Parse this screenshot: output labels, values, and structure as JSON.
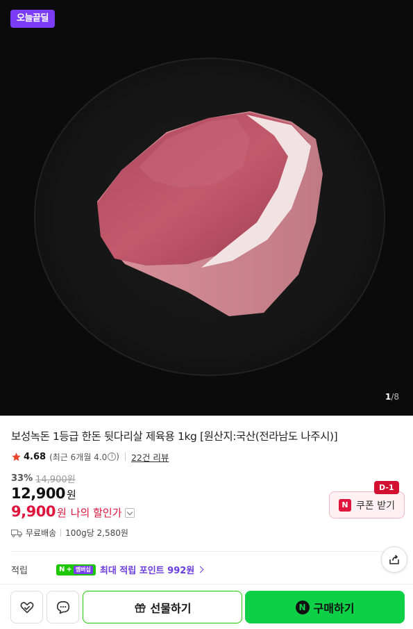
{
  "hero": {
    "badge": "오늘끝딜",
    "image_index": "1",
    "image_total": "/8"
  },
  "product": {
    "title": "보성녹돈 1등급 한돈 뒷다리살 제육용 1kg [원산지:국산(전라남도 나주시)]",
    "rating": "4.68",
    "rating_sub": "(최근 6개월 4.0",
    "rating_info": "i",
    "rating_close": ")",
    "review_link": "22건 리뷰",
    "discount_rate": "33%",
    "original_price": "14,900원",
    "price": "12,900",
    "price_unit": "원",
    "my_price": "9,900",
    "my_price_unit": "원",
    "my_price_label": "나의 할인가"
  },
  "coupon": {
    "dday": "D-1",
    "n_badge": "N",
    "label": "쿠폰 받기"
  },
  "shipping": {
    "free": "무료배송",
    "unit_price": "100g당 2,580원"
  },
  "points": {
    "label": "적립",
    "badge_n": "N",
    "badge_plus": "+",
    "badge_membership": "멤버십",
    "text": "최대 적립 포인트 992원"
  },
  "actions": {
    "gift": "선물하기",
    "buy_n": "N",
    "buy": "구매하기"
  },
  "colors": {
    "accent_red": "#e0153d",
    "naver_green": "#0ed047",
    "purple": "#7a3cf5"
  }
}
